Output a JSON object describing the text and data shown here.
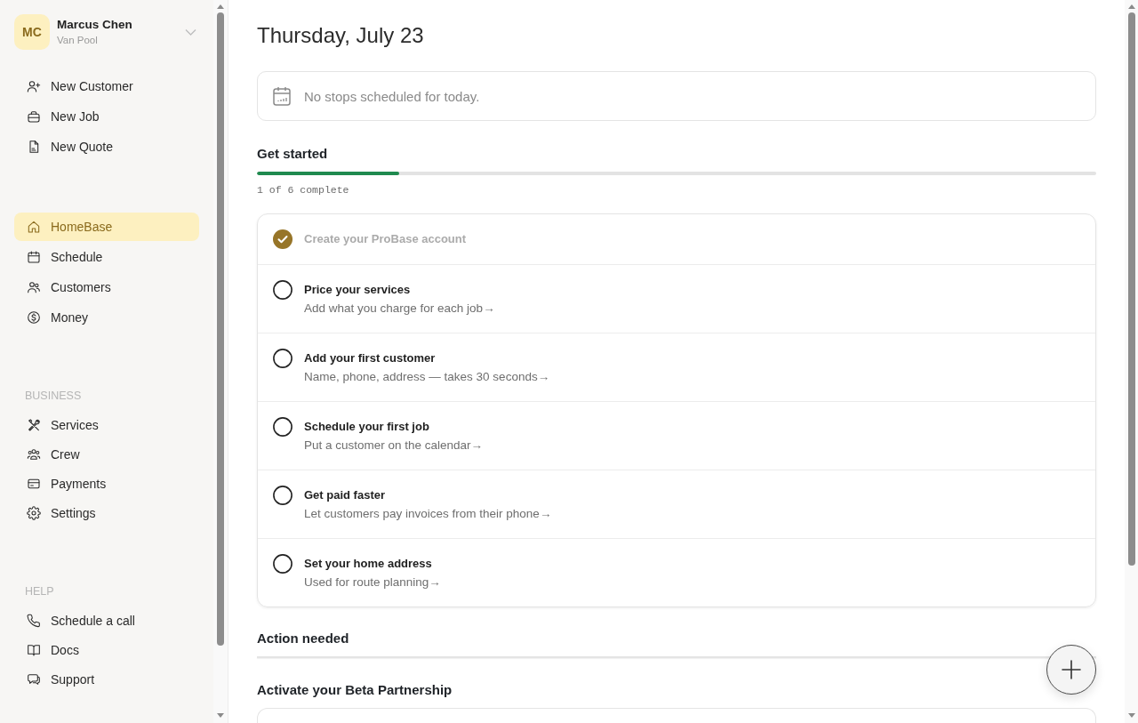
{
  "sidebar": {
    "profile": {
      "initials": "MC",
      "name": "Marcus Chen",
      "subtitle": "Van Pool"
    },
    "quick_actions": [
      {
        "label": "New Customer"
      },
      {
        "label": "New Job"
      },
      {
        "label": "New Quote"
      }
    ],
    "nav": [
      {
        "label": "HomeBase",
        "selected": true
      },
      {
        "label": "Schedule",
        "selected": false
      },
      {
        "label": "Customers",
        "selected": false
      },
      {
        "label": "Money",
        "selected": false
      }
    ],
    "sections": [
      {
        "heading": "BUSINESS",
        "items": [
          {
            "label": "Services",
            "selected": false
          },
          {
            "label": "Crew",
            "selected": false
          },
          {
            "label": "Payments",
            "selected": false
          },
          {
            "label": "Settings",
            "selected": false
          }
        ]
      },
      {
        "heading": "HELP",
        "items": [
          {
            "label": "Schedule a call"
          },
          {
            "label": "Docs"
          },
          {
            "label": "Support"
          }
        ]
      }
    ]
  },
  "main": {
    "title": "Thursday, July 23",
    "schedule_notice": "No stops scheduled for today.",
    "get_started": {
      "heading": "Get started",
      "level": 0.17,
      "progress_text": "1 of 6 complete",
      "tasks": [
        {
          "title": "Create your ProBase account",
          "checked": true
        },
        {
          "title": "Price your services",
          "description": "Add what you charge for each job→",
          "checked": false
        },
        {
          "title": "Add your first customer",
          "description": "Name, phone, address — takes 30 seconds→",
          "checked": false
        },
        {
          "title": "Schedule your first job",
          "description": "Put a customer on the calendar→",
          "checked": false
        },
        {
          "title": "Get paid faster",
          "description": "Let customers pay invoices from their phone→",
          "checked": false
        },
        {
          "title": "Set your home address",
          "description": "Used for route planning→",
          "checked": false
        }
      ]
    },
    "action_needed": {
      "heading": "Action needed"
    },
    "beta_partnership": {
      "heading": "Activate your Beta Partnership"
    }
  }
}
